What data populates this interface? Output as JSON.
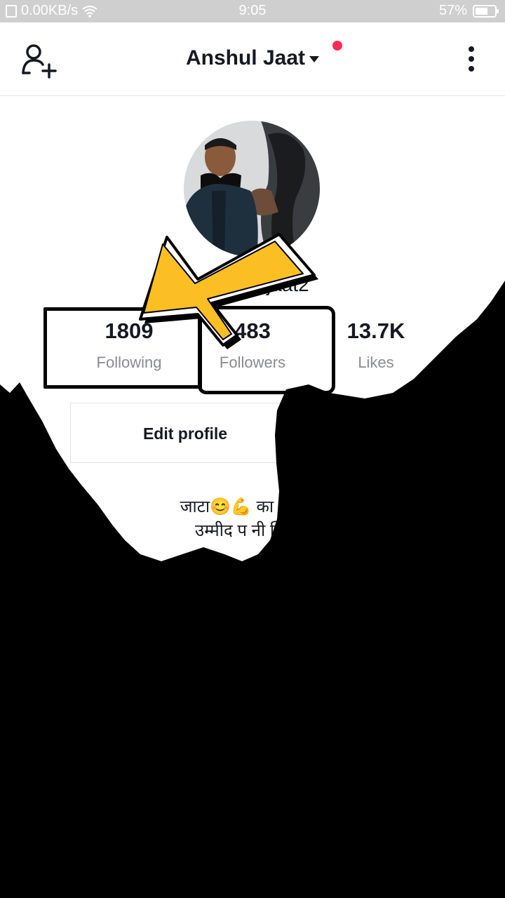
{
  "status_bar": {
    "network_speed": "0.00KB/s",
    "time": "9:05",
    "battery": "57%"
  },
  "header": {
    "title": "Anshul Jaat",
    "icons": {
      "add_user": "add-user-icon",
      "more": "more-vertical-icon",
      "dropdown": "caret-down-icon"
    }
  },
  "profile": {
    "username_visible_fragment": "jaat2",
    "stats": [
      {
        "value": "1809",
        "label": "Following"
      },
      {
        "value": "483",
        "label": "Followers"
      },
      {
        "value": "13.7K",
        "label": "Likes"
      }
    ],
    "edit_profile_label": "Edit profile",
    "bio_line1": "जाटा😊💪 का जिण क",
    "bio_line2": "उम्मीद प नी ज़िद प"
  },
  "colors": {
    "accent": "#fe2c55",
    "arrow": "#fbbf24",
    "text": "#161823",
    "muted": "#8a8b91"
  }
}
